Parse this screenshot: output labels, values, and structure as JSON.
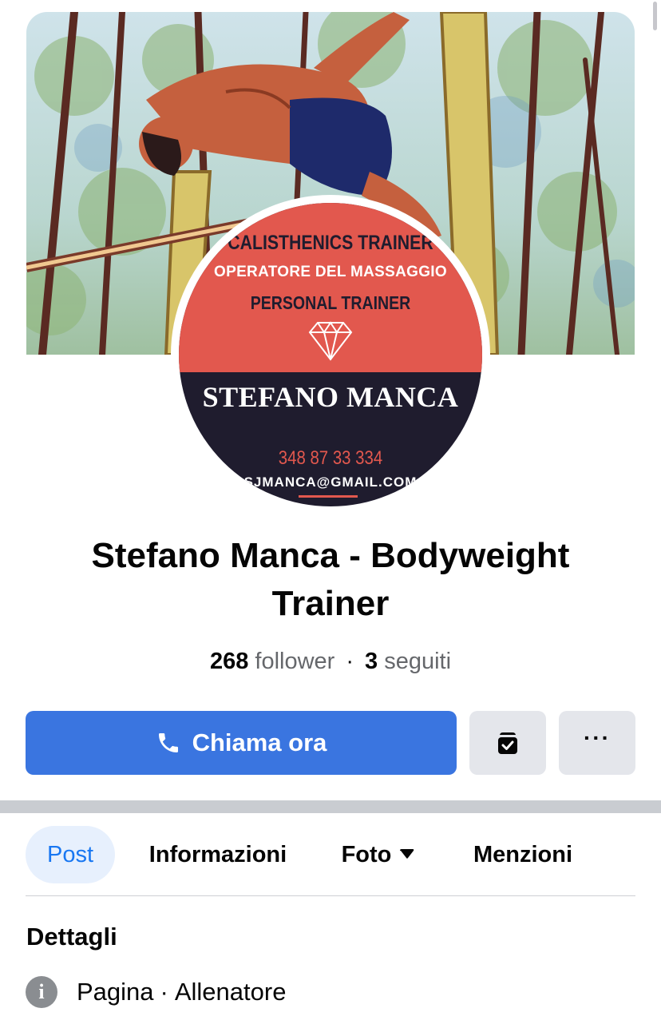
{
  "profile": {
    "name": "Stefano Manca - Bodyweight Trainer",
    "avatar": {
      "line1": "CALISTHENICS TRAINER",
      "line2": "OPERATORE DEL MASSAGGIO",
      "line3": "PERSONAL TRAINER",
      "line4": "STEFANO MANCA",
      "line5": "348 87 33 334",
      "line6": "SJMANCA@GMAIL.COM"
    },
    "followers_count": "268",
    "followers_label": "follower",
    "following_count": "3",
    "following_label": "seguiti"
  },
  "actions": {
    "call_label": "Chiama ora",
    "call_icon": "phone-icon",
    "bag_icon": "shopping-bag-check-icon",
    "more_icon": "more-dots-icon",
    "more_label": "···"
  },
  "tabs": [
    {
      "label": "Post",
      "active": true
    },
    {
      "label": "Informazioni",
      "active": false
    },
    {
      "label": "Foto",
      "active": false,
      "has_dropdown": true
    },
    {
      "label": "Menzioni",
      "active": false
    }
  ],
  "details": {
    "title": "Dettagli",
    "row_label": "Pagina",
    "row_value": "Allenatore",
    "row_icon": "info-icon"
  },
  "colors": {
    "primary_blue": "#3a75e0",
    "avatar_red": "#e2584e",
    "avatar_navy": "#1f1c2e",
    "tab_active_bg": "#e7f0fd"
  }
}
